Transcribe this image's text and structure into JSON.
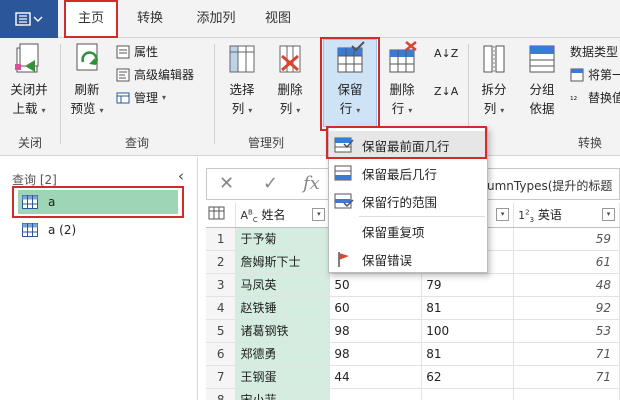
{
  "tabs": {
    "home": "主页",
    "transform": "转换",
    "add_column": "添加列",
    "view": "视图"
  },
  "ribbon": {
    "close_apply": [
      "关闭并",
      "上载"
    ],
    "refresh": [
      "刷新",
      "预览"
    ],
    "properties": "属性",
    "advanced_editor": "高级编辑器",
    "manage": "管理",
    "choose_cols": [
      "选择",
      "列"
    ],
    "remove_cols": [
      "删除",
      "列"
    ],
    "keep_rows": [
      "保留",
      "行"
    ],
    "remove_rows": [
      "删除",
      "行"
    ],
    "sort_az": "A↓Z",
    "sort_za": "Z↓A",
    "split_col": [
      "拆分",
      "列"
    ],
    "group_by": [
      "分组",
      "依据"
    ],
    "data_type": "数据类型",
    "use_first": "将第一",
    "replace": "替换值",
    "groups": {
      "close": "关闭",
      "query": "查询",
      "manage_cols": "管理列",
      "transform": "转换"
    }
  },
  "queries": {
    "header": "查询 [2]",
    "items": [
      "a",
      "a (2)"
    ]
  },
  "formula": {
    "text": "umnTypes(提升的标题"
  },
  "table": {
    "headers": {
      "name": "姓名",
      "english": "英语"
    },
    "rows": [
      {
        "n": "1",
        "name": "于予菊",
        "c1": "",
        "c2": "",
        "eng": "59"
      },
      {
        "n": "2",
        "name": "詹姆斯下士",
        "c1": "",
        "c2": "",
        "eng": "61"
      },
      {
        "n": "3",
        "name": "马凤英",
        "c1": "50",
        "c2": "79",
        "eng": "48"
      },
      {
        "n": "4",
        "name": "赵铁锤",
        "c1": "60",
        "c2": "81",
        "eng": "92"
      },
      {
        "n": "5",
        "name": "诸葛钢铁",
        "c1": "98",
        "c2": "100",
        "eng": "53"
      },
      {
        "n": "6",
        "name": "郑德勇",
        "c1": "98",
        "c2": "81",
        "eng": "71"
      },
      {
        "n": "7",
        "name": "王钢蛋",
        "c1": "44",
        "c2": "62",
        "eng": "71"
      },
      {
        "n": "8",
        "name": "宋小菲",
        "c1": "",
        "c2": "",
        "eng": ""
      }
    ]
  },
  "keep_menu": {
    "items": [
      "保留最前面几行",
      "保留最后几行",
      "保留行的范围",
      "保留重复项",
      "保留错误"
    ]
  }
}
